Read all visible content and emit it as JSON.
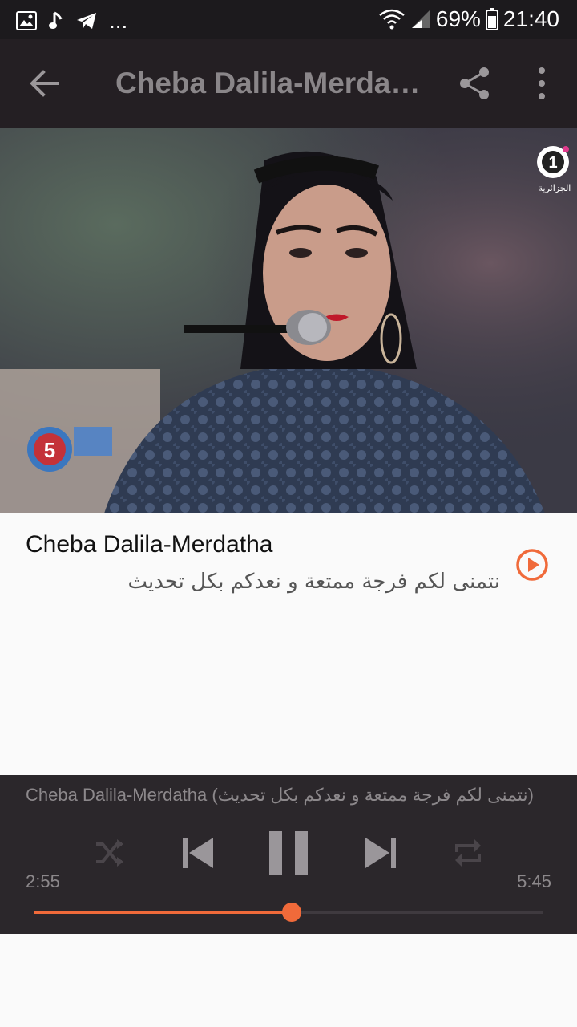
{
  "status_bar": {
    "left_icons": [
      "image-icon",
      "music-note-icon",
      "telegram-icon"
    ],
    "overflow": "...",
    "battery": "69%",
    "time": "21:40"
  },
  "app_bar": {
    "title": "Cheba Dalila-Merda…",
    "back_icon": "arrow-back-icon",
    "share_icon": "share-icon",
    "more_icon": "more-vert-icon"
  },
  "video": {
    "channel_logo_text": "الجزائرية",
    "channel_logo_number": "1"
  },
  "track": {
    "title": "Cheba Dalila-Merdatha",
    "subtitle": "نتمنى لكم فرجة ممتعة و نعدكم بكل تحديث"
  },
  "player": {
    "now_playing": "Cheba Dalila-Merdatha (نتمنى لكم فرجة ممتعة و نعدكم بكل تحديث)",
    "elapsed": "2:55",
    "duration": "5:45",
    "progress": 0.507,
    "colors": {
      "accent": "#f06a3a",
      "bg": "#2b272b"
    }
  }
}
